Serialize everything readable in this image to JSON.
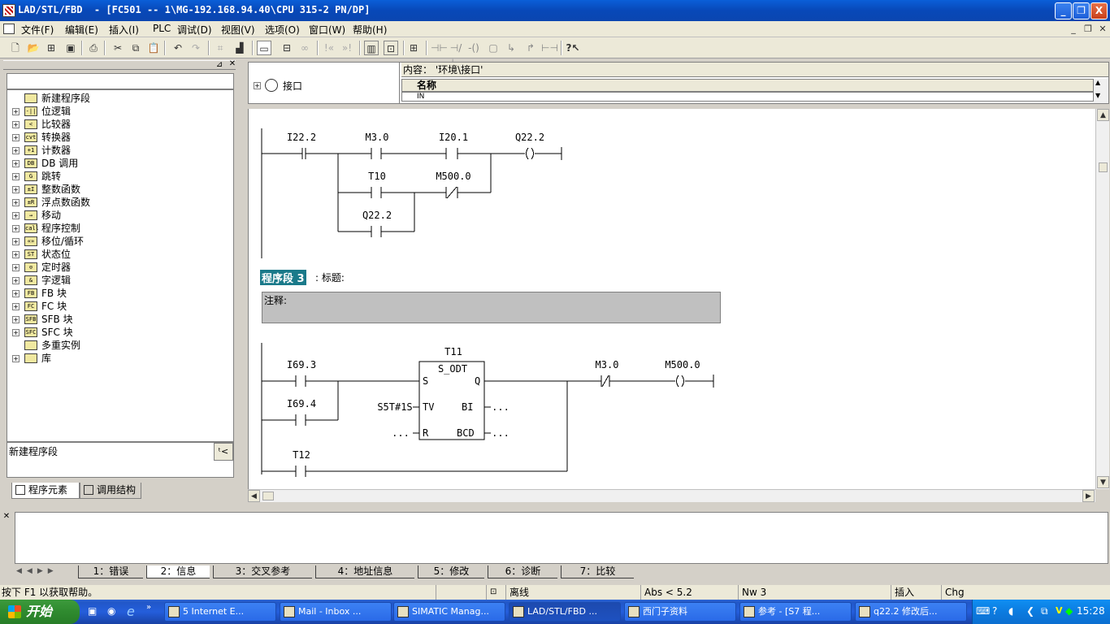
{
  "window": {
    "title": "LAD/STL/FBD  - [FC501 -- 1\\MG-192.168.94.40\\CPU 315-2 PN/DP]",
    "btn_min": "_",
    "btn_max": "❐",
    "btn_close": "X"
  },
  "menu": {
    "items": [
      "文件(F)",
      "编辑(E)",
      "插入(I)",
      "PLC",
      "调试(D)",
      "视图(V)",
      "选项(O)",
      "窗口(W)",
      "帮助(H)"
    ]
  },
  "tree": {
    "items": [
      {
        "label": "新建程序段",
        "icon": "new-network-icon",
        "expandable": false
      },
      {
        "label": "位逻辑",
        "icon": "bit-logic-icon",
        "expandable": true
      },
      {
        "label": "比较器",
        "icon": "comparator-icon",
        "expandable": true
      },
      {
        "label": "转换器",
        "icon": "converter-icon",
        "expandable": true
      },
      {
        "label": "计数器",
        "icon": "counter-icon",
        "expandable": true
      },
      {
        "label": "DB 调用",
        "icon": "db-call-icon",
        "expandable": true
      },
      {
        "label": "跳转",
        "icon": "jump-icon",
        "expandable": true
      },
      {
        "label": "整数函数",
        "icon": "integer-function-icon",
        "expandable": true
      },
      {
        "label": "浮点数函数",
        "icon": "float-function-icon",
        "expandable": true
      },
      {
        "label": "移动",
        "icon": "move-icon",
        "expandable": true
      },
      {
        "label": "程序控制",
        "icon": "program-control-icon",
        "expandable": true
      },
      {
        "label": "移位/循环",
        "icon": "shift-rotate-icon",
        "expandable": true
      },
      {
        "label": "状态位",
        "icon": "status-bit-icon",
        "expandable": true
      },
      {
        "label": "定时器",
        "icon": "timer-icon",
        "expandable": true
      },
      {
        "label": "字逻辑",
        "icon": "word-logic-icon",
        "expandable": true
      },
      {
        "label": "FB 块",
        "icon": "fb-block-icon",
        "expandable": true
      },
      {
        "label": "FC 块",
        "icon": "fc-block-icon",
        "expandable": true
      },
      {
        "label": "SFB 块",
        "icon": "sfb-block-icon",
        "expandable": true
      },
      {
        "label": "SFC 块",
        "icon": "sfc-block-icon",
        "expandable": true
      },
      {
        "label": "多重实例",
        "icon": "multi-instance-icon",
        "expandable": false
      },
      {
        "label": "库",
        "icon": "library-icon",
        "expandable": true
      }
    ],
    "icon_text": [
      "",
      "-||",
      "<",
      "cvt",
      "+1",
      "DB",
      "G",
      "±I",
      "±R",
      "→",
      "call",
      "«»",
      "ST",
      "⊙",
      "&",
      "FB",
      "FC",
      "SFB",
      "SFC",
      "",
      ""
    ]
  },
  "description": {
    "text": "新建程序段"
  },
  "left_tabs": [
    "程序元素",
    "调用结构"
  ],
  "interface": {
    "content_label": "内容：  '环境\\接口'",
    "tree_item": "接口",
    "column_header": "名称",
    "row_first": "IN"
  },
  "network2": {
    "contacts": [
      "I22.2",
      "M3.0",
      "I20.1",
      "T10",
      "M500.0",
      "Q22.2"
    ],
    "coil": "Q22.2"
  },
  "network3": {
    "title_label": "程序段 3",
    "title_suffix": ": 标题:",
    "comment": "注释:",
    "contacts": [
      "I69.3",
      "I69.4",
      "T12",
      "M3.0"
    ],
    "coil": "M500.0",
    "timer_name": "T11",
    "timer_type": "S_ODT",
    "timer_pins": {
      "s": "S",
      "q": "Q",
      "tv": "TV",
      "bi": "BI",
      "r": "R",
      "bcd": "BCD"
    },
    "tv_value": "S5T#1S",
    "placeholder": "..."
  },
  "output_tabs": [
    "1：错误",
    "2：信息",
    "3：交叉参考",
    "4：地址信息",
    "5：修改",
    "6：诊断",
    "7：比较"
  ],
  "status": {
    "help": "按下 F1 以获取帮助。",
    "mode": "离线",
    "abs": "Abs < 5.2",
    "nw": "Nw 3",
    "insert": "插入",
    "chg": "Chg"
  },
  "taskbar": {
    "start": "开始",
    "buttons": [
      "5 Internet E...",
      "Mail - Inbox ...",
      "SIMATIC Manag...",
      "LAD/STL/FBD ...",
      "西门子资料",
      "参考 - [S7 程...",
      "q22.2 修改后..."
    ],
    "clock": "15:28"
  },
  "colors": {
    "title_blue": "#0a5fd8",
    "selection_teal": "#1a7a8a",
    "comment_gray": "#c0c0c0",
    "taskbar_blue": "#245edb",
    "start_green": "#2f8a2f"
  }
}
